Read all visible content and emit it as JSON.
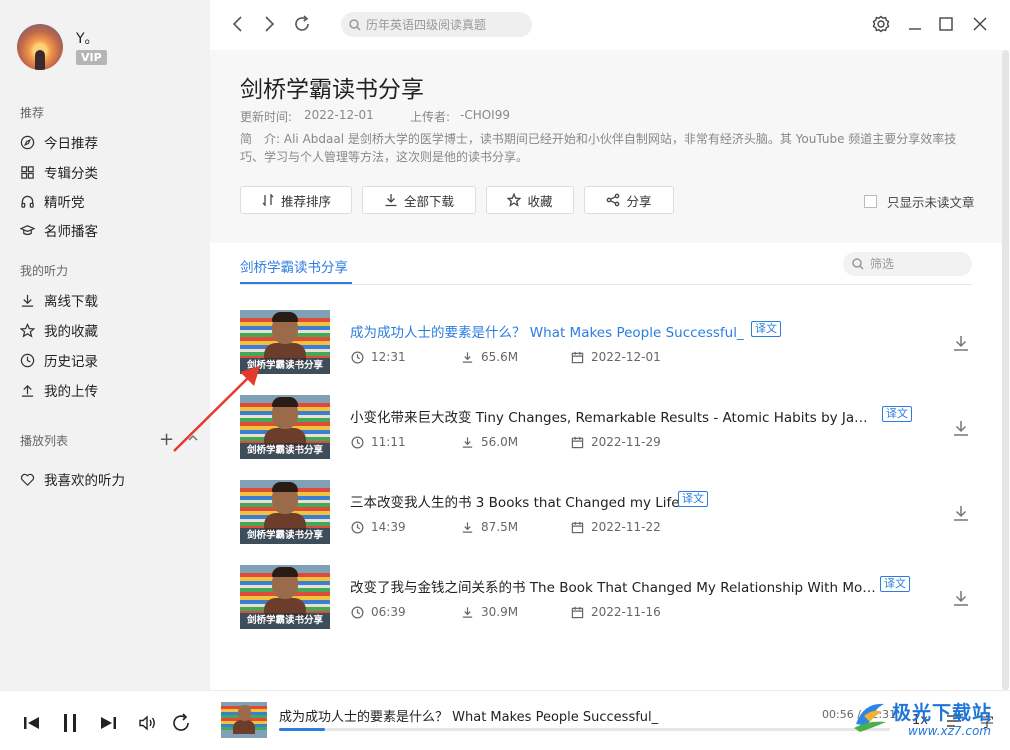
{
  "user": {
    "name": "Y。",
    "vip": "VIP"
  },
  "sidebar": {
    "sections": [
      {
        "title": "推荐",
        "items": [
          {
            "label": "今日推荐",
            "icon": "compass-icon"
          },
          {
            "label": "专辑分类",
            "icon": "grid-icon"
          },
          {
            "label": "精听党",
            "icon": "headphones-icon"
          },
          {
            "label": "名师播客",
            "icon": "graduation-cap-icon"
          }
        ]
      },
      {
        "title": "我的听力",
        "items": [
          {
            "label": "离线下载",
            "icon": "download-icon"
          },
          {
            "label": "我的收藏",
            "icon": "star-icon"
          },
          {
            "label": "历史记录",
            "icon": "clock-icon"
          },
          {
            "label": "我的上传",
            "icon": "upload-icon"
          }
        ]
      },
      {
        "title": "播放列表",
        "items": [
          {
            "label": "我喜欢的听力",
            "icon": "heart-icon"
          }
        ]
      }
    ]
  },
  "topbar": {
    "search_placeholder": "历年英语四级阅读真题"
  },
  "album": {
    "title": "剑桥学霸读书分享",
    "updated_label": "更新时间:",
    "updated": "2022-12-01",
    "uploader_label": "上传者:",
    "uploader": "-CHOI99",
    "desc_label": "简　介:",
    "desc": "Ali Abdaal 是剑桥大学的医学博士，读书期间已经开始和小伙伴自制网站，非常有经济头脑。其 YouTube 频道主要分享效率技巧、学习与个人管理等方法，这次则是他的读书分享。",
    "buttons": {
      "sort": "推荐排序",
      "download_all": "全部下载",
      "favorite": "收藏",
      "share": "分享"
    },
    "unread_only": "只显示未读文章"
  },
  "tabs": {
    "active": "剑桥学霸读书分享",
    "filter_placeholder": "筛选"
  },
  "thumb_caption": "剑桥学霸读书分享",
  "episodes": [
    {
      "title": "成为成功人士的要素是什么？ What Makes People Successful_",
      "badge": "译文",
      "duration": "12:31",
      "size": "65.6M",
      "date": "2022-12-01",
      "active": true
    },
    {
      "title": "小变化带来巨大改变 Tiny Changes, Remarkable Results - Atomic Habits by James Clear",
      "badge": "译文",
      "duration": "11:11",
      "size": "56.0M",
      "date": "2022-11-29",
      "active": false
    },
    {
      "title": "三本改变我人生的书 3 Books that Changed my Life",
      "badge": "译文",
      "duration": "14:39",
      "size": "87.5M",
      "date": "2022-11-22",
      "active": false
    },
    {
      "title": "改变了我与金钱之间关系的书 The Book That Changed My Relationship With Money",
      "badge": "译文",
      "duration": "06:39",
      "size": "30.9M",
      "date": "2022-11-16",
      "active": false
    }
  ],
  "player": {
    "title": "成为成功人士的要素是什么？ What Makes People Successful_",
    "current": "00:56",
    "total": "12:31",
    "progress": 0.075,
    "speed": "1x",
    "lyrics": "字"
  },
  "watermark": {
    "text": "极光下载站",
    "url": "www.xz7.com"
  },
  "colors": {
    "accent": "#2b7de0",
    "annotation_arrow": "#e53a2e",
    "sidebar_bg": "#f2f2f2"
  }
}
